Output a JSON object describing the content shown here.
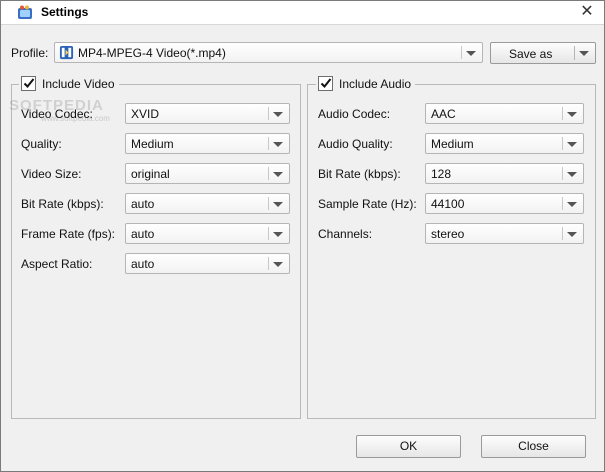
{
  "window": {
    "title": "Settings",
    "close_glyph": "✕"
  },
  "profile": {
    "label": "Profile:",
    "value": "MP4-MPEG-4 Video(*.mp4)",
    "save_as_label": "Save as"
  },
  "video": {
    "include_label": "Include Video",
    "checked": true,
    "fields": [
      {
        "label": "Video Codec:",
        "value": "XVID"
      },
      {
        "label": "Quality:",
        "value": "Medium"
      },
      {
        "label": "Video Size:",
        "value": "original"
      },
      {
        "label": "Bit Rate (kbps):",
        "value": "auto"
      },
      {
        "label": "Frame Rate (fps):",
        "value": "auto"
      },
      {
        "label": "Aspect Ratio:",
        "value": "auto"
      }
    ]
  },
  "audio": {
    "include_label": "Include Audio",
    "checked": true,
    "fields": [
      {
        "label": "Audio Codec:",
        "value": "AAC"
      },
      {
        "label": "Audio Quality:",
        "value": "Medium"
      },
      {
        "label": "Bit Rate (kbps):",
        "value": "128"
      },
      {
        "label": "Sample Rate (Hz):",
        "value": "44100"
      },
      {
        "label": "Channels:",
        "value": "stereo"
      }
    ]
  },
  "watermark": {
    "text": "SOFTPEDIA",
    "sub": "www.softpedia.com"
  },
  "footer": {
    "ok_label": "OK",
    "close_label": "Close"
  },
  "icons": {
    "app": "video-settings-icon",
    "profile": "mp4-file-icon",
    "close": "close-icon"
  }
}
